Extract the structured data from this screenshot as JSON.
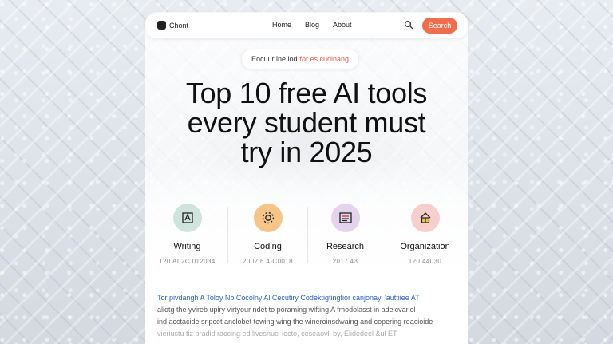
{
  "brand": {
    "name": "Chont"
  },
  "nav": {
    "links": [
      "Home",
      "Blog",
      "About"
    ],
    "search_label": "Search"
  },
  "hero": {
    "pill_part1": "Eocuur lne lod",
    "pill_part2": "for es cudlnang",
    "title_lines": [
      "Top 10 free AI tools",
      "every student must",
      "try in 2025"
    ]
  },
  "features": [
    {
      "label": "Writing",
      "sub": "120 AI 2C 012034",
      "icon": "pen-frame-icon",
      "color": "#cfe4dd"
    },
    {
      "label": "Coding",
      "sub": "2002 6 4-C0018",
      "icon": "gear-icon",
      "color": "#f6c58a"
    },
    {
      "label": "Research",
      "sub": "2017 43",
      "icon": "document-icon",
      "color": "#e3d3ec"
    },
    {
      "label": "Organization",
      "sub": "120 44030",
      "icon": "house-icon",
      "color": "#f6cfcd"
    }
  ],
  "article": {
    "lead": "Tor pivdangh A Toloy Nb Cocolny Al Cecutiry Codektigtingfior canjonayl 'auttiiee AT",
    "lines": [
      "aliotg the yvireb upiry virtyour ndet to poraming wifting A fmodolasst in adeicvariol",
      "ind acctacide sripcet anclobet tewing wing the wineroinsdwaing and copering reacioide",
      "vieriustu tiz pradid raccing ed livesnucl lecto, ceseaovli by, Elidedeel &ul ET"
    ]
  },
  "colors": {
    "accent": "#ee6f4f",
    "link": "#2a62b8"
  }
}
